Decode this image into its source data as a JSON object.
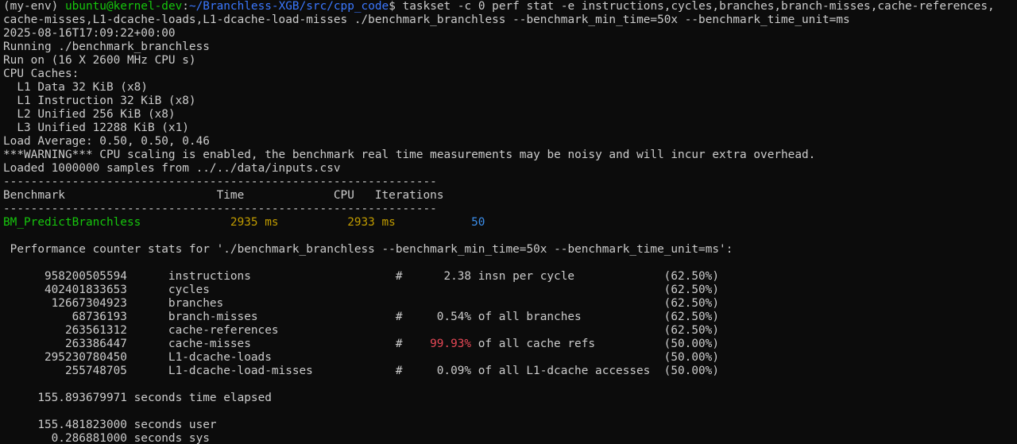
{
  "prompt": {
    "env": "(my-env) ",
    "user_host": "ubuntu@kernel-dev",
    "path_sep": ":",
    "path": "~/Branchless-XGB/src/cpp_code",
    "dollar": "$ ",
    "command": "taskset -c 0 perf stat -e instructions,cycles,branches,branch-misses,cache-references,",
    "command_cont": "cache-misses,L1-dcache-loads,L1-dcache-load-misses ./benchmark_branchless --benchmark_min_time=50x --benchmark_time_unit=ms"
  },
  "output": {
    "timestamp": "2025-08-16T17:09:22+00:00",
    "running": "Running ./benchmark_branchless",
    "run_on": "Run on (16 X 2600 MHz CPU s)",
    "cpu_caches": "CPU Caches:",
    "cache_l1d": "  L1 Data 32 KiB (x8)",
    "cache_l1i": "  L1 Instruction 32 KiB (x8)",
    "cache_l2": "  L2 Unified 256 KiB (x8)",
    "cache_l3": "  L3 Unified 12288 KiB (x1)",
    "load_avg": "Load Average: 0.50, 0.50, 0.46",
    "warning": "***WARNING*** CPU scaling is enabled, the benchmark real time measurements may be noisy and will incur extra overhead.",
    "loaded": "Loaded 1000000 samples from ../../data/inputs.csv"
  },
  "benchmark_table": {
    "separator": "---------------------------------------------------------------",
    "header": "Benchmark                      Time             CPU   Iterations",
    "row": {
      "name": "BM_PredictBranchless",
      "time": "2935 ms",
      "cpu": "2933 ms",
      "iterations": "50"
    }
  },
  "perf": {
    "title": " Performance counter stats for './benchmark_branchless --benchmark_min_time=50x --benchmark_time_unit=ms':",
    "rows": [
      {
        "count": "958200505594",
        "event": "instructions",
        "hash": "#",
        "pct": "2.38",
        "desc": "insn per cycle",
        "scale": "(62.50%)",
        "highlight": false
      },
      {
        "count": "402401833653",
        "event": "cycles",
        "hash": "",
        "pct": "",
        "desc": "",
        "scale": "(62.50%)",
        "highlight": false
      },
      {
        "count": "12667304923",
        "event": "branches",
        "hash": "",
        "pct": "",
        "desc": "",
        "scale": "(62.50%)",
        "highlight": false
      },
      {
        "count": "68736193",
        "event": "branch-misses",
        "hash": "#",
        "pct": "0.54%",
        "desc": "of all branches",
        "scale": "(62.50%)",
        "highlight": false
      },
      {
        "count": "263561312",
        "event": "cache-references",
        "hash": "",
        "pct": "",
        "desc": "",
        "scale": "(62.50%)",
        "highlight": false
      },
      {
        "count": "263386447",
        "event": "cache-misses",
        "hash": "#",
        "pct": "99.93%",
        "desc": "of all cache refs",
        "scale": "(50.00%)",
        "highlight": true
      },
      {
        "count": "295230780450",
        "event": "L1-dcache-loads",
        "hash": "",
        "pct": "",
        "desc": "",
        "scale": "(50.00%)",
        "highlight": false
      },
      {
        "count": "255748705",
        "event": "L1-dcache-load-misses",
        "hash": "#",
        "pct": "0.09%",
        "desc": "of all L1-dcache accesses",
        "scale": "(50.00%)",
        "highlight": false
      }
    ],
    "elapsed": "     155.893679971 seconds time elapsed",
    "user": "     155.481823000 seconds user",
    "sys": "       0.286881000 seconds sys"
  },
  "colors": {
    "background": "#0c0c0c",
    "foreground": "#cccccc",
    "green": "#16c60c",
    "blue_path": "#3b78ff",
    "yellow": "#c19c00",
    "iterations_blue": "#3b8eea",
    "red": "#e74856"
  }
}
